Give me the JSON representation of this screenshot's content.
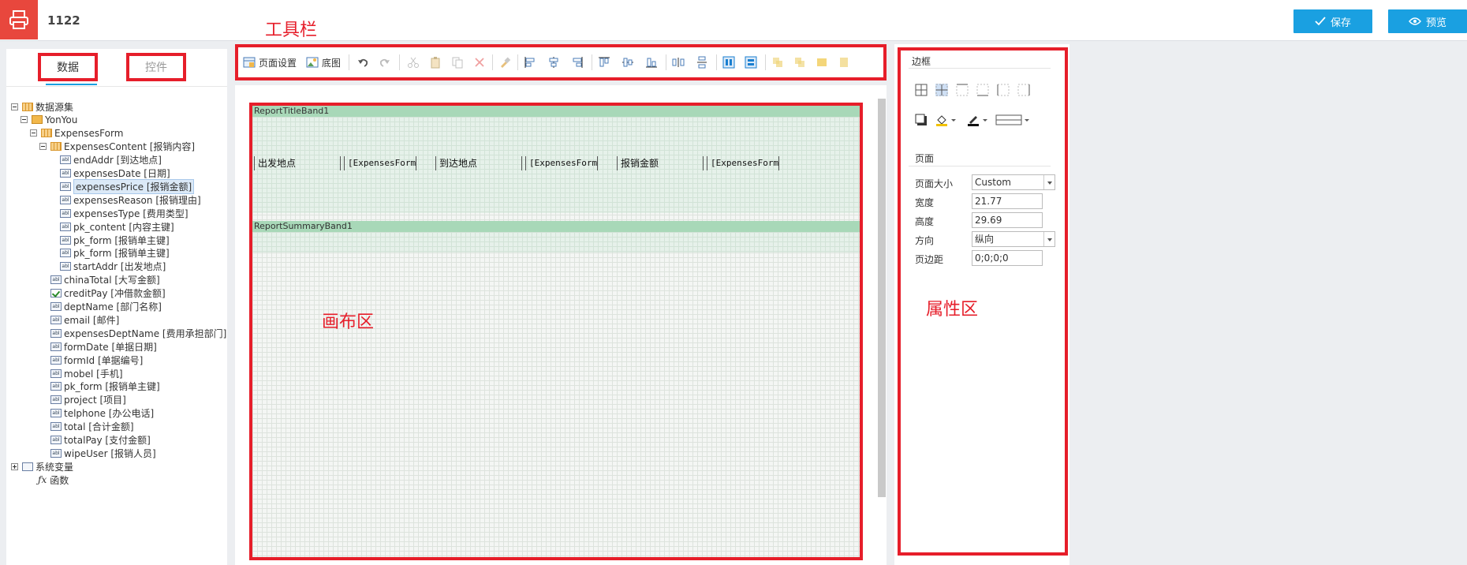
{
  "app": {
    "title": "1122",
    "save_label": "保存",
    "preview_label": "预览"
  },
  "annotations": {
    "toolbar": "工具栏",
    "canvas": "画布区",
    "properties": "属性区"
  },
  "left_panel": {
    "tabs": [
      "数据",
      "控件"
    ],
    "tree": [
      {
        "label": "数据源集",
        "level": 0,
        "expand": "minus",
        "icon": "table-icon"
      },
      {
        "label": "YonYou",
        "level": 1,
        "expand": "minus",
        "icon": "datasource-icon"
      },
      {
        "label": "ExpensesForm",
        "level": 2,
        "expand": "minus",
        "icon": "table-icon"
      },
      {
        "label": "ExpensesContent [报销内容]",
        "level": 3,
        "expand": "minus",
        "icon": "subtable-icon"
      },
      {
        "label": "endAddr [到达地点]",
        "level": 4,
        "icon": "text-field-icon"
      },
      {
        "label": "expensesDate [日期]",
        "level": 4,
        "icon": "text-field-icon"
      },
      {
        "label": "expensesPrice [报销金额]",
        "level": 4,
        "icon": "text-field-icon",
        "selected": true
      },
      {
        "label": "expensesReason [报销理由]",
        "level": 4,
        "icon": "text-field-icon"
      },
      {
        "label": "expensesType [费用类型]",
        "level": 4,
        "icon": "text-field-icon"
      },
      {
        "label": "pk_content [内容主键]",
        "level": 4,
        "icon": "text-field-icon"
      },
      {
        "label": "pk_form [报销单主键]",
        "level": 4,
        "icon": "text-field-icon"
      },
      {
        "label": "pk_form [报销单主键]",
        "level": 4,
        "icon": "text-field-icon"
      },
      {
        "label": "startAddr [出发地点]",
        "level": 4,
        "icon": "text-field-icon"
      },
      {
        "label": "chinaTotal [大写金额]",
        "level": 3,
        "icon": "text-field-icon"
      },
      {
        "label": "creditPay [冲借款金额]",
        "level": 3,
        "icon": "checkbox-field-icon"
      },
      {
        "label": "deptName [部门名称]",
        "level": 3,
        "icon": "text-field-icon"
      },
      {
        "label": "email [邮件]",
        "level": 3,
        "icon": "text-field-icon"
      },
      {
        "label": "expensesDeptName [费用承担部门]",
        "level": 3,
        "icon": "text-field-icon"
      },
      {
        "label": "formDate [单据日期]",
        "level": 3,
        "icon": "text-field-icon"
      },
      {
        "label": "formId [单据编号]",
        "level": 3,
        "icon": "text-field-icon"
      },
      {
        "label": "mobel [手机]",
        "level": 3,
        "icon": "text-field-icon"
      },
      {
        "label": "pk_form [报销单主键]",
        "level": 3,
        "icon": "text-field-icon"
      },
      {
        "label": "project [项目]",
        "level": 3,
        "icon": "text-field-icon"
      },
      {
        "label": "telphone [办公电话]",
        "level": 3,
        "icon": "text-field-icon"
      },
      {
        "label": "total [合计金额]",
        "level": 3,
        "icon": "text-field-icon"
      },
      {
        "label": "totalPay [支付金额]",
        "level": 3,
        "icon": "text-field-icon"
      },
      {
        "label": "wipeUser [报销人员]",
        "level": 3,
        "icon": "text-field-icon"
      },
      {
        "label": "系统变量",
        "level": 0,
        "expand": "plus",
        "icon": "system-variable-icon"
      },
      {
        "label": "函数",
        "level": 1,
        "icon": "function-icon"
      }
    ]
  },
  "toolbar": {
    "page_setup_label": "页面设置",
    "background_label": "底图"
  },
  "canvas": {
    "title_band": "ReportTitleBand1",
    "summary_band": "ReportSummaryBand1",
    "cells": [
      "出发地点",
      "[ExpensesForm.报销",
      "到达地点",
      "[ExpensesForm.报销",
      "报销金额",
      "[ExpensesForm.报销"
    ]
  },
  "properties": {
    "border_title": "边框",
    "page_title": "页面",
    "page_size_label": "页面大小",
    "page_size_value": "Custom",
    "width_label": "宽度",
    "width_value": "21.77",
    "height_label": "高度",
    "height_value": "29.69",
    "orientation_label": "方向",
    "orientation_value": "纵向",
    "margin_label": "页边距",
    "margin_value": "0;0;0;0"
  }
}
